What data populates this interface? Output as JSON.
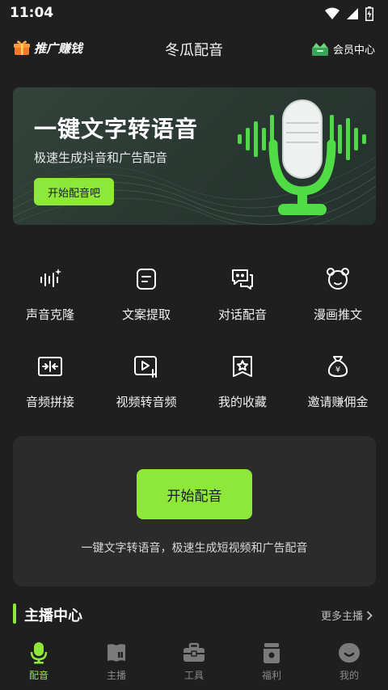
{
  "status_bar": {
    "time": "11:04",
    "icons": [
      "wifi-icon",
      "signal-icon",
      "battery-icon"
    ]
  },
  "header": {
    "promo_label": "推广赚钱",
    "app_title": "冬瓜配音",
    "member_label": "会员中心"
  },
  "banner": {
    "title": "一键文字转语音",
    "subtitle": "极速生成抖音和广告配音",
    "button_label": "开始配音吧"
  },
  "features": [
    {
      "label": "声音克隆",
      "icon": "sound-wave-sparkle-icon"
    },
    {
      "label": "文案提取",
      "icon": "text-extract-icon"
    },
    {
      "label": "对话配音",
      "icon": "chat-bubbles-icon"
    },
    {
      "label": "漫画推文",
      "icon": "bear-face-icon"
    },
    {
      "label": "音频拼接",
      "icon": "audio-merge-icon"
    },
    {
      "label": "视频转音频",
      "icon": "video-to-audio-icon"
    },
    {
      "label": "我的收藏",
      "icon": "star-bookmark-icon"
    },
    {
      "label": "邀请赚佣金",
      "icon": "money-bag-icon"
    }
  ],
  "start_card": {
    "button_label": "开始配音",
    "description": "一键文字转语音，极速生成短视频和广告配音"
  },
  "section": {
    "title": "主播中心",
    "more_label": "更多主播"
  },
  "bottom_nav": [
    {
      "label": "配音",
      "icon": "microphone-icon",
      "active": true
    },
    {
      "label": "主播",
      "icon": "anchor-book-icon",
      "active": false
    },
    {
      "label": "工具",
      "icon": "toolbox-icon",
      "active": false
    },
    {
      "label": "福利",
      "icon": "gift-jar-icon",
      "active": false
    },
    {
      "label": "我的",
      "icon": "profile-icon",
      "active": false
    }
  ],
  "colors": {
    "accent": "#8ee83a",
    "background": "#1f1f1f",
    "card": "#2b2b2b"
  }
}
